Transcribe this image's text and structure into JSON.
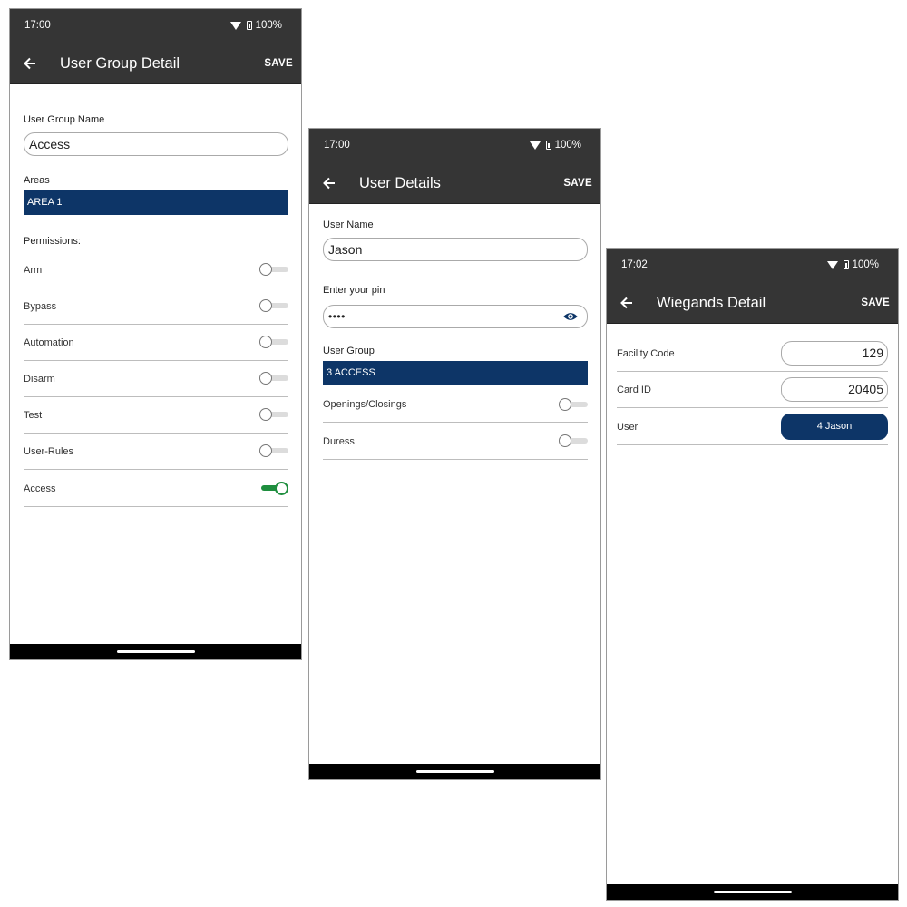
{
  "screens": [
    {
      "time": "17:00",
      "battery": "100%",
      "title": "User Group Detail",
      "save_label": "SAVE",
      "group_name_label": "User Group Name",
      "group_name_value": "Access",
      "areas_label": "Areas",
      "areas_value": "AREA 1",
      "permissions_label": "Permissions:",
      "permissions": [
        {
          "label": "Arm",
          "on": false
        },
        {
          "label": "Bypass",
          "on": false
        },
        {
          "label": "Automation",
          "on": false
        },
        {
          "label": "Disarm",
          "on": false
        },
        {
          "label": "Test",
          "on": false
        },
        {
          "label": "User-Rules",
          "on": false
        },
        {
          "label": "Access",
          "on": true
        }
      ]
    },
    {
      "time": "17:00",
      "battery": "100%",
      "title": "User Details",
      "save_label": "SAVE",
      "user_name_label": "User Name",
      "user_name_value": "Jason",
      "pin_label": "Enter your pin",
      "pin_value": "••••",
      "user_group_label": "User Group",
      "user_group_value": "3 ACCESS",
      "options": [
        {
          "label": "Openings/Closings",
          "on": false
        },
        {
          "label": "Duress",
          "on": false
        }
      ]
    },
    {
      "time": "17:02",
      "battery": "100%",
      "title": "Wiegands Detail",
      "save_label": "SAVE",
      "facility_code_label": "Facility Code",
      "facility_code_value": "129",
      "card_id_label": "Card ID",
      "card_id_value": "20405",
      "user_label": "User",
      "user_value": "4 Jason"
    }
  ],
  "icons": {
    "back": "arrow-left-icon",
    "wifi": "wifi-icon",
    "battery": "battery-icon",
    "eye": "eye-icon"
  },
  "colors": {
    "bar": "#353535",
    "accent_blue": "#0d3567",
    "toggle_on": "#1e8e3e"
  }
}
